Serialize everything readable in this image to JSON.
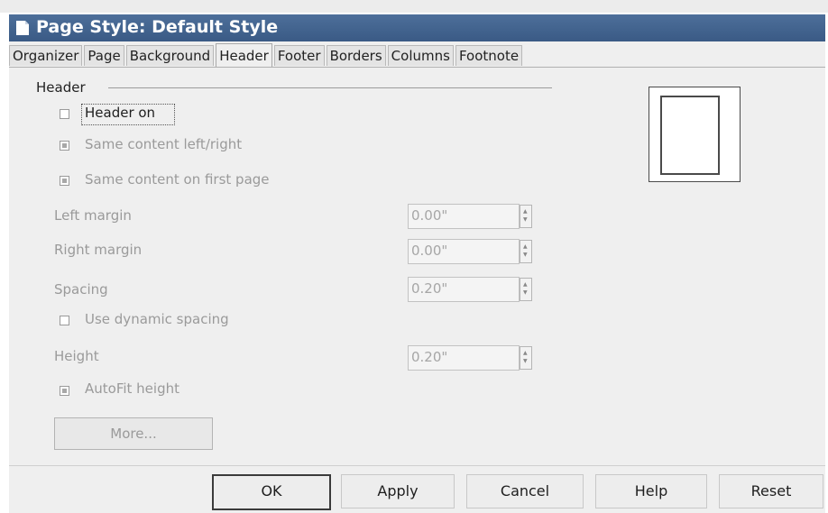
{
  "window": {
    "title": "Page Style: Default Style"
  },
  "tabs": [
    "Organizer",
    "Page",
    "Background",
    "Header",
    "Footer",
    "Borders",
    "Columns",
    "Footnote"
  ],
  "active_tab": "Header",
  "section": {
    "label": "Header"
  },
  "checkboxes": {
    "header_on": {
      "label": "Header on",
      "checked": false
    },
    "same_lr": {
      "label": "Same content left/right",
      "checked": true
    },
    "same_first": {
      "label": "Same content on first page",
      "checked": true
    },
    "dynamic_spacing": {
      "label": "Use dynamic spacing",
      "checked": false
    },
    "autofit": {
      "label": "AutoFit height",
      "checked": true
    }
  },
  "fields": {
    "left_margin": {
      "label": "Left margin",
      "value": "0.00\""
    },
    "right_margin": {
      "label": "Right margin",
      "value": "0.00\""
    },
    "spacing": {
      "label": "Spacing",
      "value": "0.20\""
    },
    "height": {
      "label": "Height",
      "value": "0.20\""
    }
  },
  "buttons": {
    "more": "More...",
    "ok": "OK",
    "apply": "Apply",
    "cancel": "Cancel",
    "help": "Help",
    "reset": "Reset"
  }
}
